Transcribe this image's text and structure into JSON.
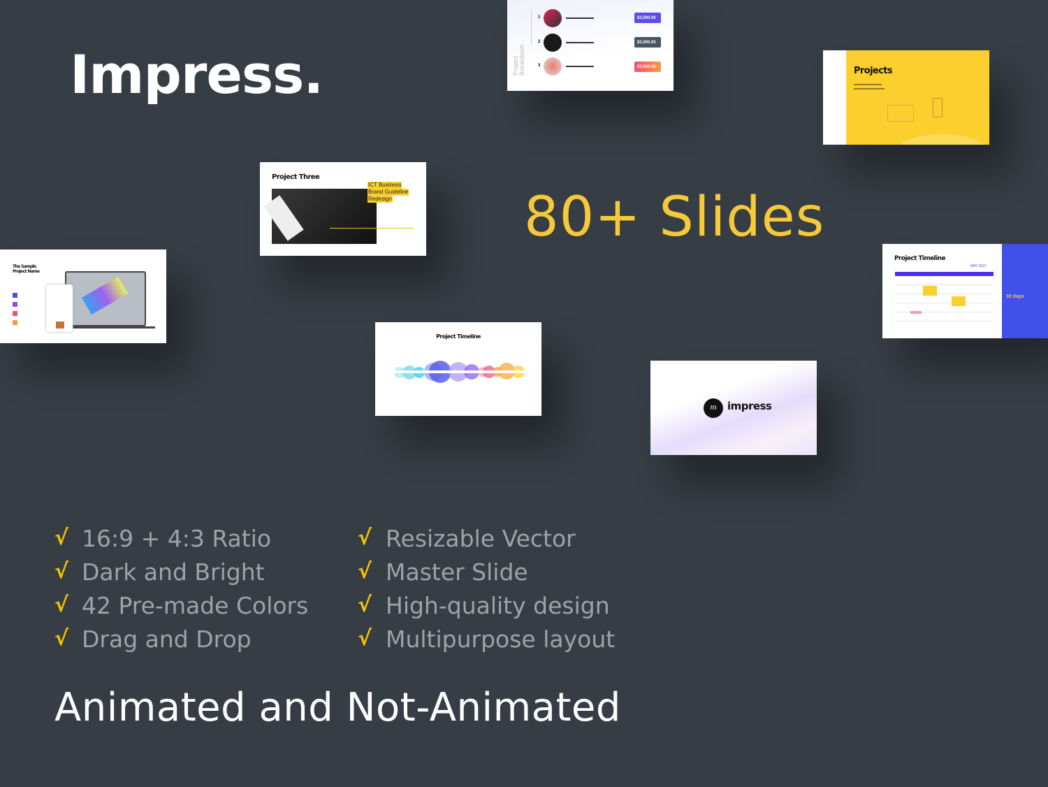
{
  "brand": {
    "title": "Impress.",
    "slide_count": "80+ Slides",
    "tagline": "Animated and Not-Animated"
  },
  "colors": {
    "background": "#373d45",
    "accent_yellow": "#f5c93a",
    "feature_text": "#9ea3aa",
    "slide_blue": "#4150e8"
  },
  "features": {
    "left": [
      "16:9 + 4:3 Ratio",
      "Dark and Bright",
      "42 Pre-made Colors",
      "Drag and Drop"
    ],
    "right": [
      "Resizable Vector",
      "Master Slide",
      "High-quality design",
      "Multipurpose layout"
    ],
    "check_icon": "checkmark-icon"
  },
  "slides": {
    "breakdown": {
      "title": "Project Breakdown",
      "rows": [
        {
          "num": "1",
          "price": "$3,500.00",
          "color": "#5b4de8"
        },
        {
          "num": "2",
          "price": "$3,500.00",
          "color": "#4a5361"
        },
        {
          "num": "3",
          "price": "$3,500.00",
          "color": "#f66a4a"
        }
      ]
    },
    "projects": {
      "title": "Projects"
    },
    "project_three": {
      "title": "Project Three",
      "highlight": [
        "ICT Business",
        "Brand Guideline",
        "Redesign"
      ]
    },
    "sample": {
      "title_lines": [
        "The Sample",
        "Project Name"
      ]
    },
    "timeline_calendar": {
      "title": "Project Timeline",
      "month": "MAY 2021",
      "days_label": "10 days"
    },
    "timeline_circles": {
      "title": "Project Timeline"
    },
    "cover": {
      "logo_text": "impress"
    }
  }
}
